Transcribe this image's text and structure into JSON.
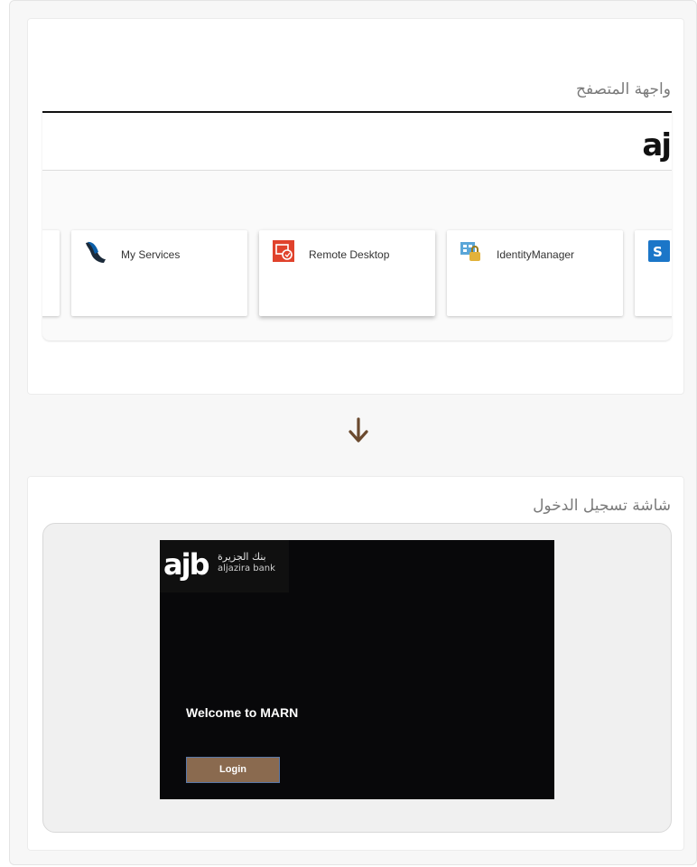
{
  "browser_section": {
    "title": "واجهة المتصفح",
    "logo_text": "aj",
    "tiles": [
      {
        "label": "",
        "icon": "partial-tile-icon"
      },
      {
        "label": "My Services",
        "icon": "my-services-icon"
      },
      {
        "label": "Remote Desktop",
        "icon": "remote-desktop-icon"
      },
      {
        "label": "IdentityManager",
        "icon": "identity-manager-icon"
      },
      {
        "label": "",
        "icon": "sharepoint-icon"
      }
    ]
  },
  "arrow": {
    "icon": "arrow-down-icon",
    "color": "#6b4a2f"
  },
  "login_section": {
    "title": "شاشة تسجيل الدخول",
    "logo_mark": "ajb",
    "logo_ar": "بنك الجزيرة",
    "logo_en": "aljazira bank",
    "welcome": "Welcome to MARN",
    "login_button": "Login",
    "button_color": "#8a6a4f"
  }
}
